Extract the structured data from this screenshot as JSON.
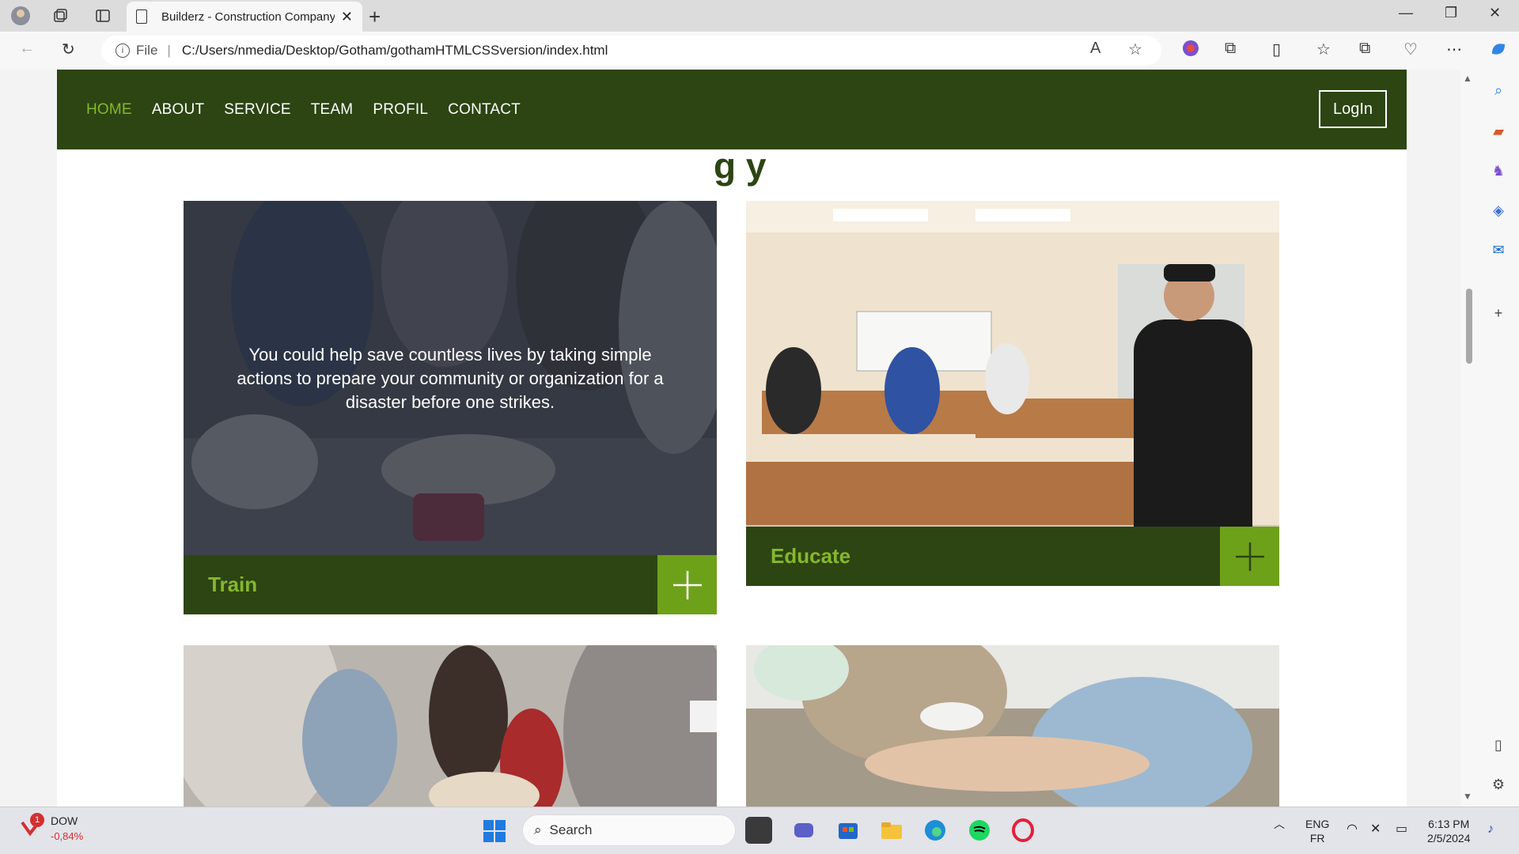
{
  "browser": {
    "tab_title": "Builderz - Construction Company",
    "tab_close": "✕",
    "new_tab": "+",
    "address_file": "File",
    "address_separator": "|",
    "url": "C:/Users/nmedia/Desktop/Gotham/gothamHTMLCSSversion/index.html"
  },
  "site": {
    "nav": [
      "HOME",
      "ABOUT",
      "SERVICE",
      "TEAM",
      "PROFIL",
      "CONTACT"
    ],
    "active_nav": "HOME",
    "login_label": "LogIn",
    "heading_peek": "g y",
    "cards": [
      {
        "label": "Train",
        "overlay_text": "You could help save countless lives by taking simple actions to prepare your community or organization for a disaster before one strikes."
      },
      {
        "label": "Educate"
      }
    ],
    "colors": {
      "nav_bg": "#2c4513",
      "accent": "#86b82b",
      "plus_bg": "#6ea11a"
    }
  },
  "taskbar": {
    "stock_symbol": "DOW",
    "stock_change": "-0,84%",
    "stock_badge": "1",
    "search_placeholder": "Search",
    "lang_top": "ENG",
    "lang_bottom": "FR",
    "time": "6:13 PM",
    "date": "2/5/2024"
  }
}
